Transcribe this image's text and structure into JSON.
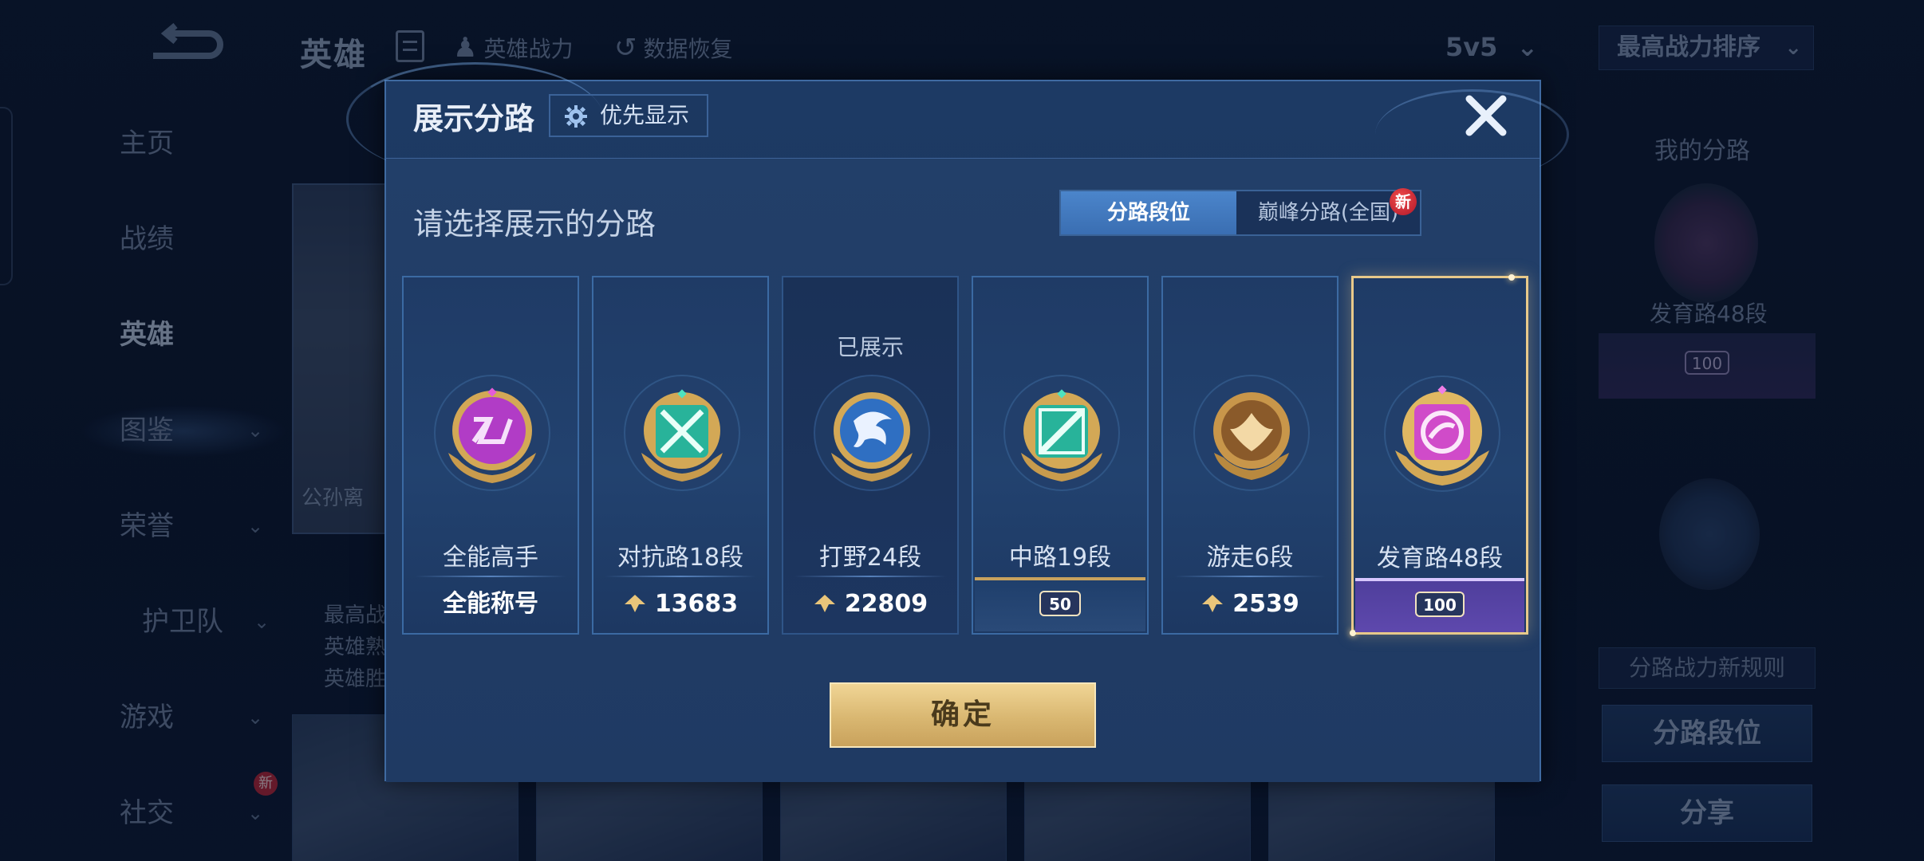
{
  "background": {
    "title": "英雄",
    "tools": [
      {
        "label": "英雄战力",
        "icon": "hero-power-icon"
      },
      {
        "label": "数据恢复",
        "icon": "data-restore-icon"
      }
    ],
    "mode": "5v5",
    "sort": "最高战力排序",
    "sidebar": [
      {
        "label": "主页"
      },
      {
        "label": "战绩"
      },
      {
        "label": "英雄"
      },
      {
        "label": "图鉴"
      },
      {
        "label": "荣誉"
      },
      {
        "label": "护卫队"
      },
      {
        "label": "游戏"
      },
      {
        "label": "社交"
      }
    ],
    "sidebar_new_badge": "新",
    "hero_name": "公孙离",
    "hero_lines": [
      "最高战",
      "英雄熟",
      "英雄胜"
    ],
    "right_panel": {
      "label": "我的分路",
      "lane_text": "发育路48段",
      "lane_rank": "100",
      "rule_button": "分路战力新规则",
      "lane_rank_button": "分路段位",
      "share_button": "分享"
    }
  },
  "modal": {
    "title": "展示分路",
    "priority_button": "优先显示",
    "subtitle": "请选择展示的分路",
    "tabs": {
      "active": "分路段位",
      "inactive": "巅峰分路(全国)",
      "new_badge": "新"
    },
    "lanes": [
      {
        "name": "全能高手",
        "footer": "全能称号",
        "badge_color": "#b43cc4",
        "status": ""
      },
      {
        "name": "对抗路18段",
        "footer": "13683",
        "badge_color": "#29b79a",
        "status": ""
      },
      {
        "name": "打野24段",
        "footer": "22809",
        "badge_color": "#3a78c8",
        "status": "已展示"
      },
      {
        "name": "中路19段",
        "footer": "50",
        "badge_color": "#29b79a",
        "status": ""
      },
      {
        "name": "游走6段",
        "footer": "2539",
        "badge_color": "#c8964a",
        "status": ""
      },
      {
        "name": "发育路48段",
        "footer": "100",
        "badge_color": "#d04bc9",
        "status": ""
      }
    ],
    "confirm_button": "确定"
  }
}
